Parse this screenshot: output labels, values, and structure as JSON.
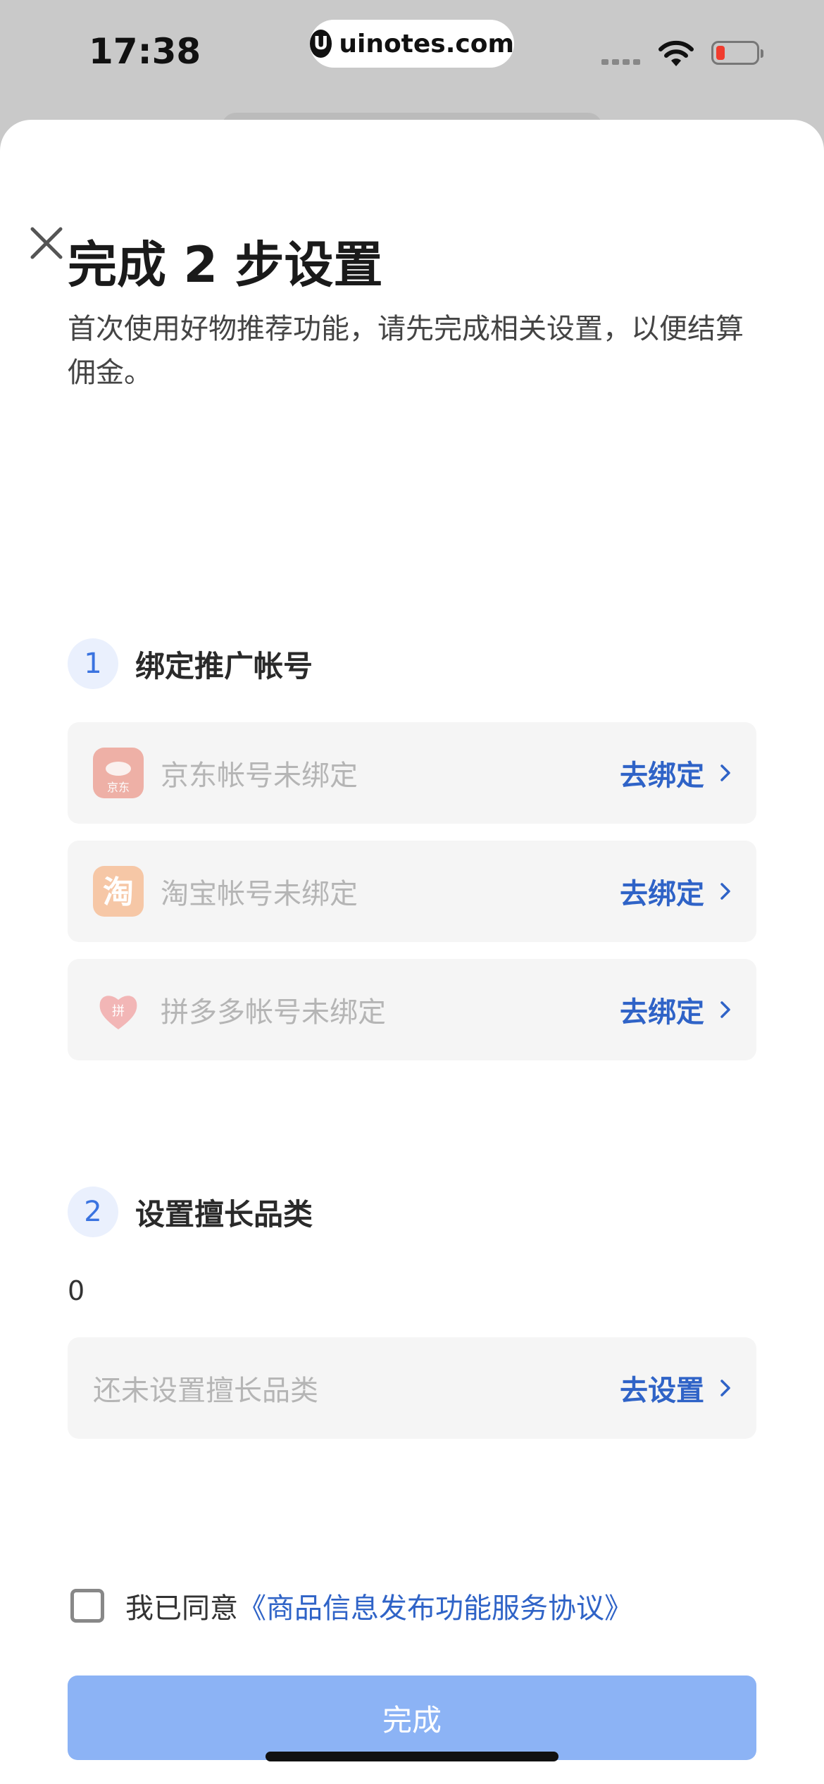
{
  "status_bar": {
    "time": "17:38",
    "url": "uinotes.com"
  },
  "sheet": {
    "title": "完成 2 步设置",
    "subtitle": "首次使用好物推荐功能，请先完成相关设置，以便结算佣金。",
    "step1": {
      "number": "1",
      "label": "绑定推广帐号",
      "items": [
        {
          "icon": "jd-icon",
          "icon_text": "京东",
          "text": "京东帐号未绑定",
          "action": "去绑定"
        },
        {
          "icon": "taobao-icon",
          "icon_text": "淘",
          "text": "淘宝帐号未绑定",
          "action": "去绑定"
        },
        {
          "icon": "pinduoduo-icon",
          "icon_text": "拼",
          "text": "拼多多帐号未绑定",
          "action": "去绑定"
        }
      ]
    },
    "step2": {
      "number": "2",
      "label": "设置擅长品类",
      "count": "0",
      "card_text": "还未设置擅长品类",
      "action": "去设置"
    },
    "agreement": {
      "prefix": "我已同意",
      "link": "《商品信息发布功能服务协议》",
      "checked": false
    },
    "done_button": "完成"
  },
  "colors": {
    "accent": "#2f63c7",
    "button_disabled": "#8cb3f5"
  }
}
